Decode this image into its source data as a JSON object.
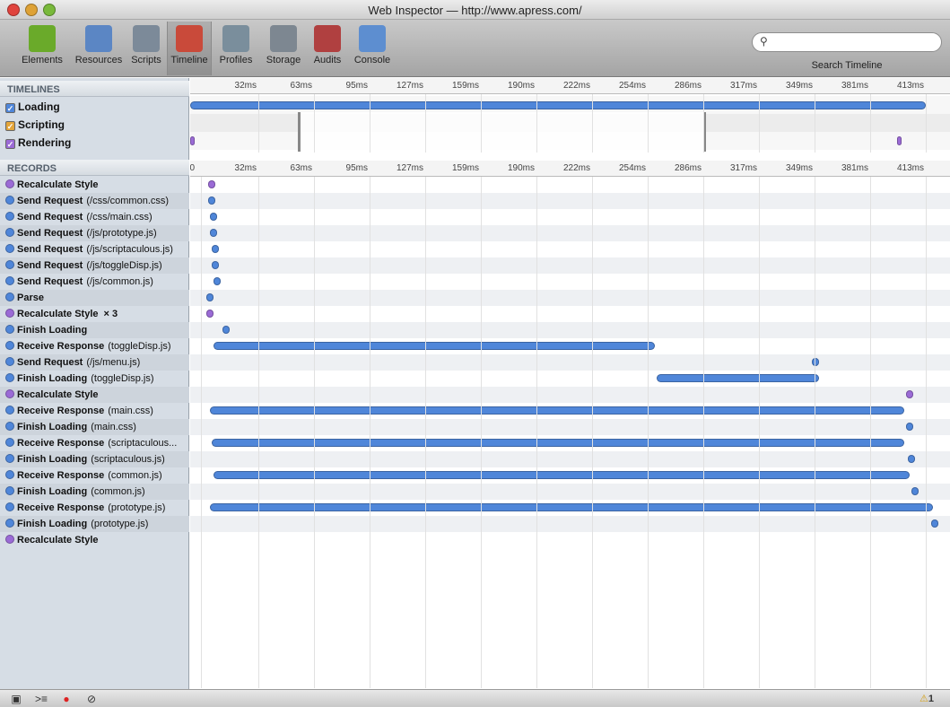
{
  "window": {
    "title": "Web Inspector — http://www.apress.com/"
  },
  "toolbar": {
    "items": [
      {
        "label": "Elements",
        "icon": "elements-icon",
        "color": "#6aaa2a"
      },
      {
        "label": "Resources",
        "icon": "resources-icon",
        "color": "#5b86c4"
      },
      {
        "label": "Scripts",
        "icon": "scripts-icon",
        "color": "#7c8a99"
      },
      {
        "label": "Timeline",
        "icon": "timeline-icon",
        "color": "#c94a3a"
      },
      {
        "label": "Profiles",
        "icon": "profiles-icon",
        "color": "#7a8e9c"
      },
      {
        "label": "Storage",
        "icon": "storage-icon",
        "color": "#7d8791"
      },
      {
        "label": "Audits",
        "icon": "audits-icon",
        "color": "#b04040"
      },
      {
        "label": "Console",
        "icon": "console-icon",
        "color": "#5d8ed0"
      }
    ],
    "selected": "Timeline"
  },
  "search": {
    "placeholder": "",
    "label": "Search Timeline"
  },
  "timelines": {
    "header": "TIMELINES",
    "categories": [
      {
        "label": "Loading",
        "color": "#4f86d9"
      },
      {
        "label": "Scripting",
        "color": "#e4a53a"
      },
      {
        "label": "Rendering",
        "color": "#9b6bd6"
      }
    ]
  },
  "ticks": [
    "32ms",
    "63ms",
    "95ms",
    "127ms",
    "159ms",
    "190ms",
    "222ms",
    "254ms",
    "286ms",
    "317ms",
    "349ms",
    "381ms",
    "413ms"
  ],
  "records_header": "RECORDS",
  "records_zero": "0",
  "records": [
    {
      "name": "Recalculate Style",
      "detail": "",
      "type": "rendering",
      "start": 5,
      "end": 5
    },
    {
      "name": "Send Request",
      "detail": "(/css/common.css)",
      "type": "loading",
      "start": 5,
      "end": 5
    },
    {
      "name": "Send Request",
      "detail": "(/css/main.css)",
      "type": "loading",
      "start": 6,
      "end": 6
    },
    {
      "name": "Send Request",
      "detail": "(/js/prototype.js)",
      "type": "loading",
      "start": 6,
      "end": 6
    },
    {
      "name": "Send Request",
      "detail": "(/js/scriptaculous.js)",
      "type": "loading",
      "start": 7,
      "end": 7
    },
    {
      "name": "Send Request",
      "detail": "(/js/toggleDisp.js)",
      "type": "loading",
      "start": 7,
      "end": 7
    },
    {
      "name": "Send Request",
      "detail": "(/js/common.js)",
      "type": "loading",
      "start": 8,
      "end": 8
    },
    {
      "name": "Parse",
      "detail": "",
      "type": "loading",
      "start": 4,
      "end": 4
    },
    {
      "name": "Recalculate Style",
      "detail": "",
      "count": "× 3",
      "type": "rendering",
      "start": 4,
      "end": 4
    },
    {
      "name": "Finish Loading",
      "detail": "",
      "type": "loading",
      "start": 13,
      "end": 13
    },
    {
      "name": "Receive Response",
      "detail": "(toggleDisp.js)",
      "type": "loading",
      "start": 6,
      "end": 254
    },
    {
      "name": "Send Request",
      "detail": "(/js/menu.js)",
      "type": "loading",
      "start": 344,
      "end": 344
    },
    {
      "name": "Finish Loading",
      "detail": "(toggleDisp.js)",
      "type": "loading",
      "start": 255,
      "end": 346
    },
    {
      "name": "Recalculate Style",
      "detail": "",
      "type": "rendering",
      "start": 397,
      "end": 397
    },
    {
      "name": "Receive Response",
      "detail": "(main.css)",
      "type": "loading",
      "start": 4,
      "end": 394
    },
    {
      "name": "Finish Loading",
      "detail": "(main.css)",
      "type": "loading",
      "start": 397,
      "end": 397
    },
    {
      "name": "Receive Response",
      "detail": "(scriptaculous...",
      "type": "loading",
      "start": 5,
      "end": 394
    },
    {
      "name": "Finish Loading",
      "detail": "(scriptaculous.js)",
      "type": "loading",
      "start": 398,
      "end": 398
    },
    {
      "name": "Receive Response",
      "detail": "(common.js)",
      "type": "loading",
      "start": 6,
      "end": 397
    },
    {
      "name": "Finish Loading",
      "detail": "(common.js)",
      "type": "loading",
      "start": 400,
      "end": 400
    },
    {
      "name": "Receive Response",
      "detail": "(prototype.js)",
      "type": "loading",
      "start": 4,
      "end": 410
    },
    {
      "name": "Finish Loading",
      "detail": "(prototype.js)",
      "type": "loading",
      "start": 411,
      "end": 411
    },
    {
      "name": "Recalculate Style",
      "detail": "",
      "type": "rendering",
      "start": 0,
      "end": 0,
      "hidden_bar": true
    }
  ],
  "status": {
    "warning_count": "1"
  },
  "colors": {
    "loading": "#4f86d9",
    "rendering": "#9b6bd6",
    "scripting": "#e4a53a"
  }
}
